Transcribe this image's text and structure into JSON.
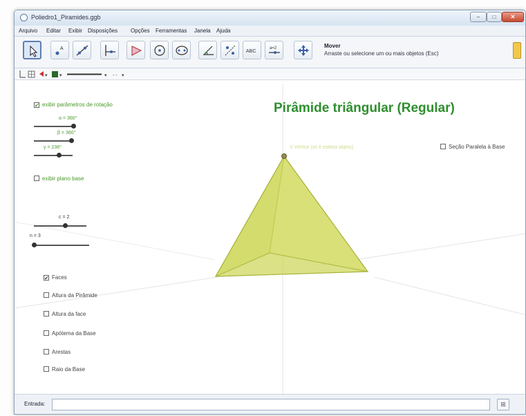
{
  "window": {
    "title": "Poliedro1_Piramides.ggb",
    "buttons": {
      "minimize": "–",
      "maximize": "□",
      "close": "✕"
    }
  },
  "menu": [
    "Arquivo",
    "Editar",
    "Exibir",
    "Disposições",
    "Opções",
    "Ferramentas",
    "Janela",
    "Ajuda"
  ],
  "toolbar": {
    "tools": [
      "move-tool",
      "point-tool",
      "line-tool",
      "perpendicular-tool",
      "polygon-tool",
      "circle-tool",
      "conic-tool",
      "angle-tool",
      "reflect-tool",
      "text-tool",
      "slider-tool",
      "move-graphics-tool"
    ],
    "help_name": "Mover",
    "help_desc": "Arraste ou selecione um ou mais objetos (Esc)"
  },
  "graphics": {
    "heading": "Pirâmide triângular (Regular)",
    "apex_label": "V Vértice (só é esteira objeto)",
    "checkboxes": {
      "rotation": {
        "label": "exibir parâmetros de rotação",
        "checked": "✔"
      },
      "base_plane": {
        "label": "exibir plano base",
        "checked": ""
      },
      "section": {
        "label": "Seção Paralela à Base",
        "checked": ""
      },
      "faces": {
        "label": "Faces",
        "checked": "✔"
      },
      "height": {
        "label": "Altura da Pirâmide",
        "checked": ""
      },
      "face_height": {
        "label": "Altura da face",
        "checked": ""
      },
      "apothem": {
        "label": "Apótema da Base",
        "checked": ""
      },
      "edges": {
        "label": "Arestas",
        "checked": ""
      },
      "radius": {
        "label": "Raio da Base",
        "checked": ""
      }
    },
    "sliders": {
      "alpha": {
        "label": "α = 360°",
        "level": 0.95
      },
      "beta": {
        "label": "β = 360°",
        "level": 0.98
      },
      "gamma": {
        "label": "γ = 238°",
        "level": 0.66
      },
      "c": {
        "label": "c = 2",
        "level": 0.6
      },
      "n": {
        "label": "n = 3",
        "level": 0.0
      }
    }
  },
  "input": {
    "label": "Entrada:",
    "value": "",
    "button": "⊞"
  },
  "colors": {
    "pyramid_fill": "#d4dc66",
    "pyramid_edge": "#a7b23a",
    "heading": "#2f8f2f",
    "label_green": "#4a9a2a"
  }
}
